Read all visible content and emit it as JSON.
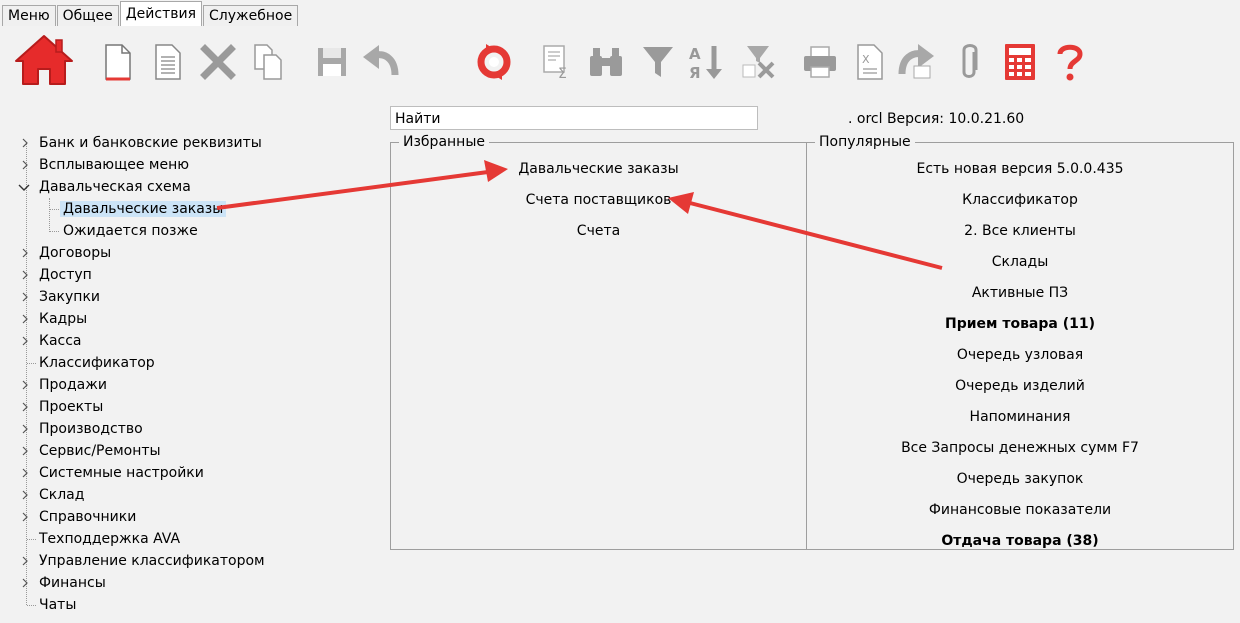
{
  "tabs": [
    {
      "label": "Меню"
    },
    {
      "label": "Общее"
    },
    {
      "label": "Действия"
    },
    {
      "label": "Служебное"
    }
  ],
  "toolbar": {
    "icons": [
      "home-icon",
      "new-document-icon",
      "document-icon",
      "delete-icon",
      "copy-icon",
      "save-icon",
      "undo-icon",
      "refresh-icon",
      "sum-icon",
      "binoculars-icon",
      "filter-icon",
      "sort-icon",
      "clear-filter-icon",
      "print-icon",
      "excel-export-icon",
      "redo-icon",
      "attach-icon",
      "calculator-icon",
      "help-icon"
    ]
  },
  "search": {
    "placeholder": "Найти"
  },
  "version": {
    "text": ". orcl Версия: 10.0.21.60"
  },
  "tree": {
    "nodes": [
      {
        "label": "Банк и банковские реквизиты"
      },
      {
        "label": "Всплывающее меню"
      },
      {
        "label": "Давальческая схема"
      },
      {
        "label": "Давальческие заказы"
      },
      {
        "label": "Ожидается позже"
      },
      {
        "label": "Договоры"
      },
      {
        "label": "Доступ"
      },
      {
        "label": "Закупки"
      },
      {
        "label": "Кадры"
      },
      {
        "label": "Касса"
      },
      {
        "label": "Классификатор"
      },
      {
        "label": "Продажи"
      },
      {
        "label": "Проекты"
      },
      {
        "label": "Производство"
      },
      {
        "label": "Сервис/Ремонты"
      },
      {
        "label": "Системные настройки"
      },
      {
        "label": "Склад"
      },
      {
        "label": "Справочники"
      },
      {
        "label": "Техподдержка AVA"
      },
      {
        "label": "Управление классификатором"
      },
      {
        "label": "Финансы"
      },
      {
        "label": "Чаты"
      }
    ]
  },
  "favorites": {
    "title": "Избранные",
    "items": [
      {
        "label": "Давальческие заказы"
      },
      {
        "label": "Счета поставщиков"
      },
      {
        "label": "Счета"
      }
    ]
  },
  "popular": {
    "title": "Популярные",
    "items": [
      {
        "label": "Есть новая версия 5.0.0.435"
      },
      {
        "label": "Классификатор"
      },
      {
        "label": "2. Все клиенты"
      },
      {
        "label": "Склады"
      },
      {
        "label": "Активные ПЗ"
      },
      {
        "label": "Прием товара (11)"
      },
      {
        "label": "Очередь узловая"
      },
      {
        "label": "Очередь изделий"
      },
      {
        "label": "Напоминания"
      },
      {
        "label": "Все Запросы денежных сумм F7"
      },
      {
        "label": "Очередь закупок"
      },
      {
        "label": "Финансовые показатели"
      },
      {
        "label": "Отдача товара (38)"
      }
    ]
  },
  "colors": {
    "accent": "#e53935",
    "selection": "#cce4f7",
    "annotation_arrow": "#e53935"
  }
}
